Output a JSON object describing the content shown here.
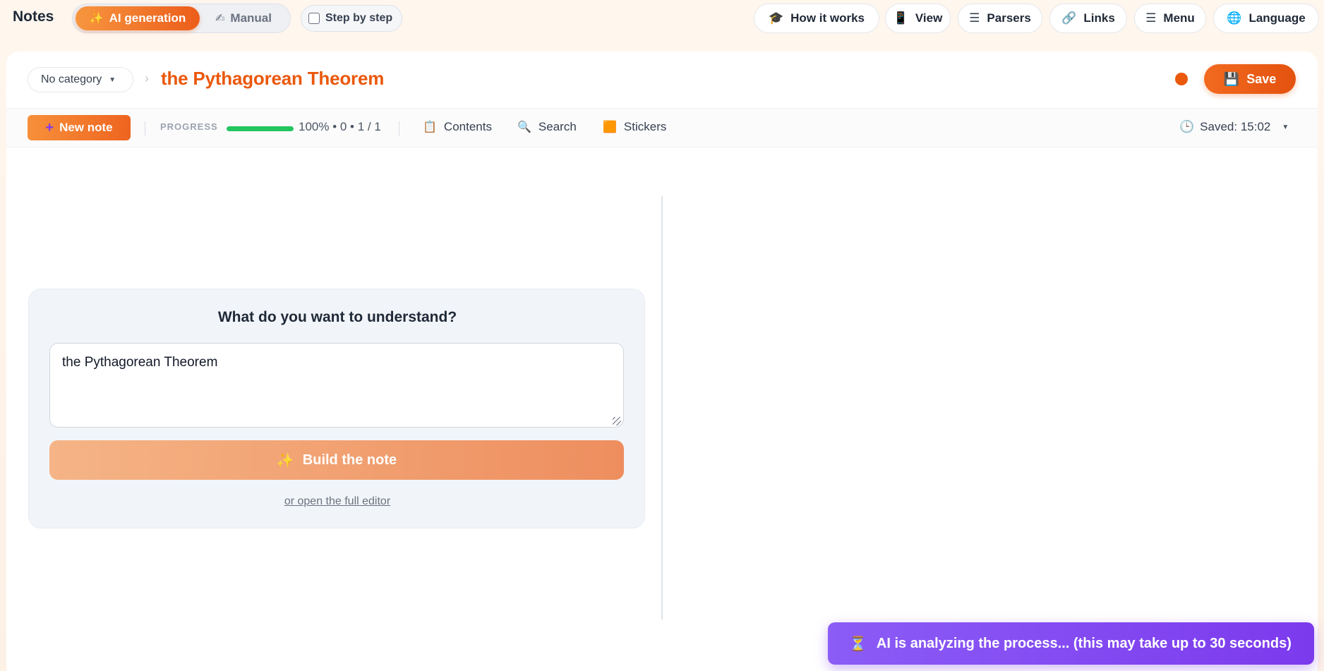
{
  "app": {
    "title": "Notes"
  },
  "modes": {
    "ai": {
      "icon": "sparkles-icon",
      "glyph": "✨",
      "label": "AI generation"
    },
    "manual": {
      "icon": "writing-hand-icon",
      "glyph": "✍",
      "label": "Manual"
    }
  },
  "step_by_step": {
    "label": "Step by step",
    "checked": false
  },
  "top_nav": [
    {
      "name": "how-it-works",
      "icon": "graduation-cap-icon",
      "glyph": "🎓",
      "label": "How it works"
    },
    {
      "name": "view",
      "icon": "phone-icon",
      "glyph": "📱",
      "label": "View"
    },
    {
      "name": "parsers",
      "icon": "list-icon",
      "glyph": "☰",
      "label": "Parsers"
    },
    {
      "name": "links",
      "icon": "link-icon",
      "glyph": "🔗",
      "label": "Links"
    },
    {
      "name": "menu",
      "icon": "hamburger-icon",
      "glyph": "☰",
      "label": "Menu"
    },
    {
      "name": "language",
      "icon": "globe-icon",
      "glyph": "🌐",
      "label": "Language"
    }
  ],
  "header": {
    "category": "No category",
    "breadcrumb_sep": "›",
    "title": "the Pythagorean Theorem",
    "save_label": "Save",
    "status_color": "#ea580c"
  },
  "toolbar": {
    "new_note_label": "New note",
    "progress_label": "PROGRESS",
    "progress_percent": 100,
    "progress_text": "100% • 0 • 1 / 1",
    "contents_label": "Contents",
    "search_label": "Search",
    "stickers_label": "Stickers",
    "saved_label": "Saved: 15:02"
  },
  "prompt": {
    "question": "What do you want to understand?",
    "value": "the Pythagorean Theorem",
    "build_label": "Build the note",
    "editor_link": "or open the full editor"
  },
  "toast": {
    "message": "AI is analyzing the process... (this may take up to 30 seconds)"
  },
  "colors": {
    "accent": "#ea580c",
    "progress": "#22c55e",
    "toast": "#8b5cf6"
  }
}
